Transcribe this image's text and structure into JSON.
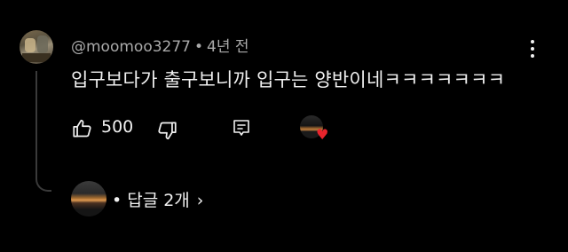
{
  "comment": {
    "author": "@moomoo3277",
    "separator": "•",
    "time": "4년 전",
    "text": "입구보다가 출구보니까 입구는 양반이네ㅋㅋㅋㅋㅋㅋㅋ",
    "like_count": "500"
  },
  "replies": {
    "separator": "•",
    "label": "답글 2개",
    "chevron": "›"
  },
  "icons": {
    "like": "thumbs-up-icon",
    "dislike": "thumbs-down-icon",
    "reply": "reply-icon",
    "menu": "more-vert-icon",
    "heart": "heart-icon"
  },
  "colors": {
    "background": "#000000",
    "text": "#f1f1f1",
    "meta_text": "#aaaaaa",
    "heart": "#e8242c"
  }
}
